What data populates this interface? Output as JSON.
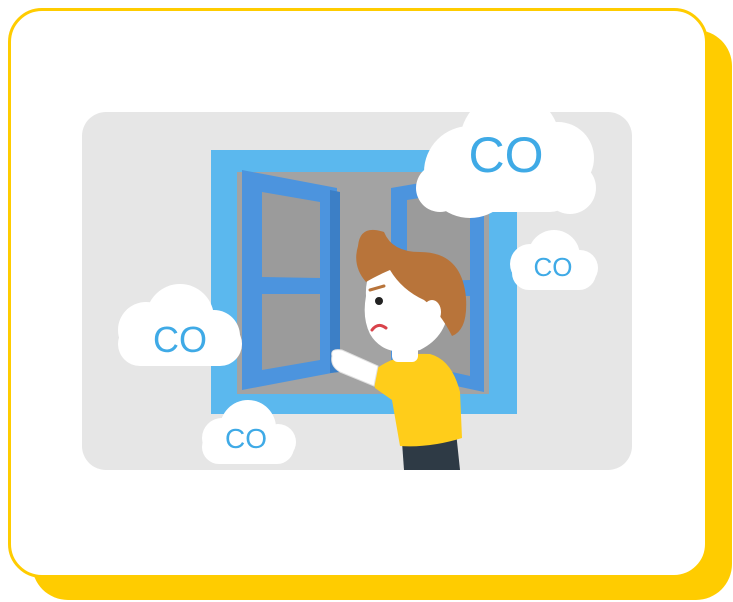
{
  "colors": {
    "card_border": "#FFCC00",
    "card_shadow": "#FFCC00",
    "panel": "#E6E6E6",
    "window_frame": "#5BB8EE",
    "window_sash": "#4C94DE",
    "window_glass": "#A3A3A3",
    "cloud": "#FFFFFF",
    "cloud_text": "#3FAAE6",
    "hair": "#B8743A",
    "shirt": "#FFCD1A",
    "trousers": "#2E3A45",
    "skin": "#FFFFFF"
  },
  "clouds": [
    {
      "id": "large",
      "label": "CO"
    },
    {
      "id": "right",
      "label": "CO"
    },
    {
      "id": "left",
      "label": "CO"
    },
    {
      "id": "bottom",
      "label": "CO"
    }
  ]
}
